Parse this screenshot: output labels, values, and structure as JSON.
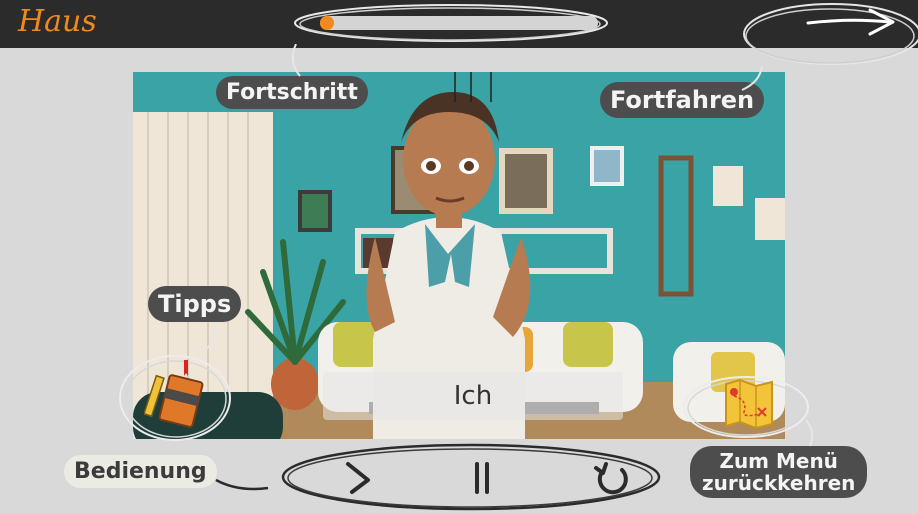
{
  "app": {
    "logo_text": "Haus"
  },
  "progress": {
    "value": 0.0,
    "accent": "#f08a1c"
  },
  "labels": {
    "progress": "Fortschritt",
    "continue": "Fortfahren",
    "tips": "Tipps",
    "controls": "Bedienung",
    "menu_line1": "Zum Menü",
    "menu_line2": "zurückkehren"
  },
  "scene": {
    "caption": "Ich"
  },
  "icons": {
    "next": "arrow-right-icon",
    "tips": "notebook-pencil-icon",
    "menu": "map-icon",
    "play": "play-icon",
    "pause": "pause-icon",
    "replay": "replay-icon"
  },
  "colors": {
    "topbar": "#2b2b2b",
    "background": "#d9d9d9",
    "accent": "#f08a1c",
    "bubble_dark": "#4d4d4d",
    "bubble_light": "#ecebe3",
    "wall": "#3aa3a6"
  }
}
